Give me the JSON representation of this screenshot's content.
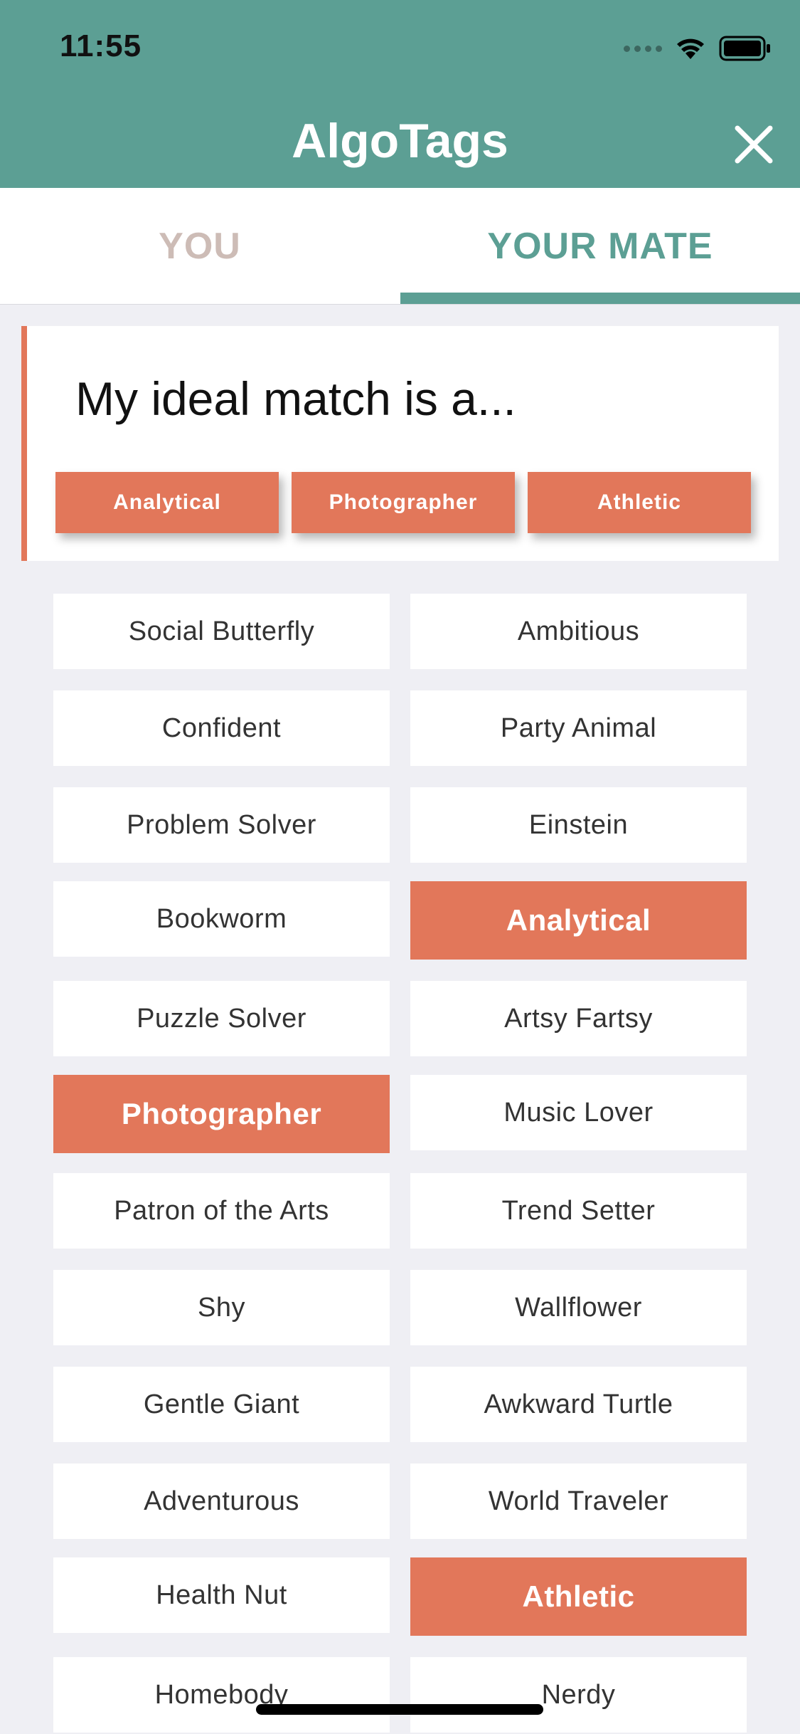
{
  "status_bar": {
    "time": "11:55"
  },
  "header": {
    "title": "AlgoTags",
    "close_icon": "close-icon",
    "background": "#5c9f94"
  },
  "tabs": [
    {
      "label": "YOU",
      "active": false
    },
    {
      "label": "YOUR MATE",
      "active": true
    }
  ],
  "match_card": {
    "heading": "My ideal match is a...",
    "tags": [
      "Analytical",
      "Photographer",
      "Athletic"
    ]
  },
  "tags": [
    {
      "label": "Social Butterfly",
      "selected": false
    },
    {
      "label": "Ambitious",
      "selected": false
    },
    {
      "label": "Confident",
      "selected": false
    },
    {
      "label": "Party Animal",
      "selected": false
    },
    {
      "label": "Problem Solver",
      "selected": false
    },
    {
      "label": "Einstein",
      "selected": false
    },
    {
      "label": "Bookworm",
      "selected": false
    },
    {
      "label": "Analytical",
      "selected": true
    },
    {
      "label": "Puzzle Solver",
      "selected": false
    },
    {
      "label": "Artsy Fartsy",
      "selected": false
    },
    {
      "label": "Photographer",
      "selected": true
    },
    {
      "label": "Music Lover",
      "selected": false
    },
    {
      "label": "Patron of the Arts",
      "selected": false
    },
    {
      "label": "Trend Setter",
      "selected": false
    },
    {
      "label": "Shy",
      "selected": false
    },
    {
      "label": "Wallflower",
      "selected": false
    },
    {
      "label": "Gentle Giant",
      "selected": false
    },
    {
      "label": "Awkward Turtle",
      "selected": false
    },
    {
      "label": "Adventurous",
      "selected": false
    },
    {
      "label": "World Traveler",
      "selected": false
    },
    {
      "label": "Health Nut",
      "selected": false
    },
    {
      "label": "Athletic",
      "selected": true
    },
    {
      "label": "Homebody",
      "selected": false
    },
    {
      "label": "Nerdy",
      "selected": false
    }
  ],
  "colors": {
    "accent": "#e2775a",
    "brand": "#5c9f94",
    "inactive_tab": "#cdbcb6"
  }
}
